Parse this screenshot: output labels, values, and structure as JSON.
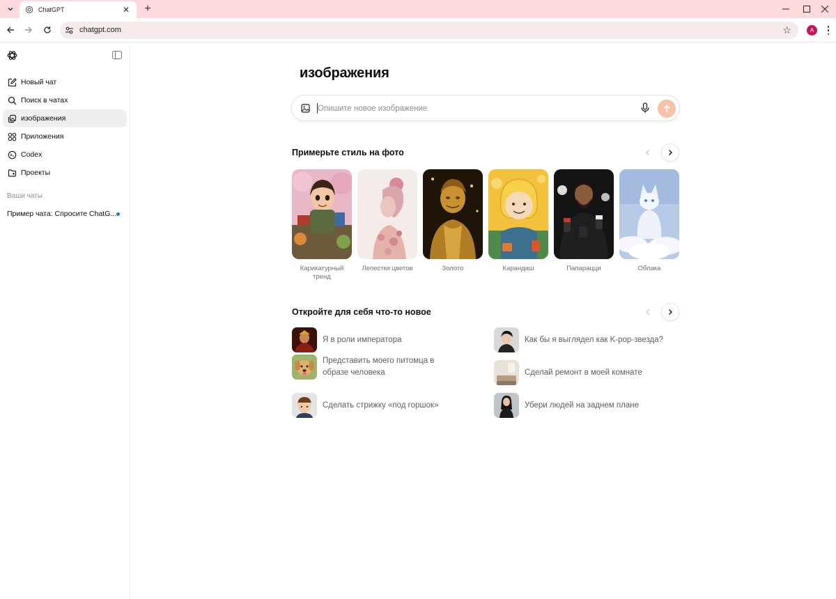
{
  "browser": {
    "tab_title": "ChatGPT",
    "url": "chatgpt.com",
    "profile_initial": "A",
    "accent": "#fbd9dc"
  },
  "sidebar": {
    "items": [
      {
        "label": "Новый чат",
        "icon": "new-chat-icon"
      },
      {
        "label": "Поиск в чатах",
        "icon": "search-icon"
      },
      {
        "label": "изображения",
        "icon": "images-icon",
        "active": true
      },
      {
        "label": "Приложения",
        "icon": "apps-icon"
      },
      {
        "label": "Codex",
        "icon": "codex-icon"
      },
      {
        "label": "Проекты",
        "icon": "folder-icon"
      }
    ],
    "section_label": "Ваши чаты",
    "chats": [
      {
        "label": "Пример чата: Спросите ChatG...",
        "unread": true
      }
    ]
  },
  "main": {
    "title": "изображения",
    "prompt": {
      "placeholder": "Опишите новое изображение",
      "value": ""
    },
    "styles_section": {
      "title": "Примерьте стиль на фото",
      "cards": [
        {
          "label": "Карикатурный тренд"
        },
        {
          "label": "Лепестки цветов"
        },
        {
          "label": "Золото"
        },
        {
          "label": "Карандаш"
        },
        {
          "label": "Папарацци"
        },
        {
          "label": "Облака"
        }
      ]
    },
    "discover_section": {
      "title": "Откройте для себя что-то новое",
      "items": [
        {
          "label": "Я в роли императора"
        },
        {
          "label": "Как бы я выглядел как K-pop-звезда?"
        },
        {
          "label": "Представить моего питомца в образе человека"
        },
        {
          "label": "Сделай ремонт в моей комнате"
        },
        {
          "label": "Сделать стрижку «под горшок»"
        },
        {
          "label": "Убери людей на заднем плане"
        }
      ]
    },
    "send_button_color": "#f8c2a8"
  }
}
